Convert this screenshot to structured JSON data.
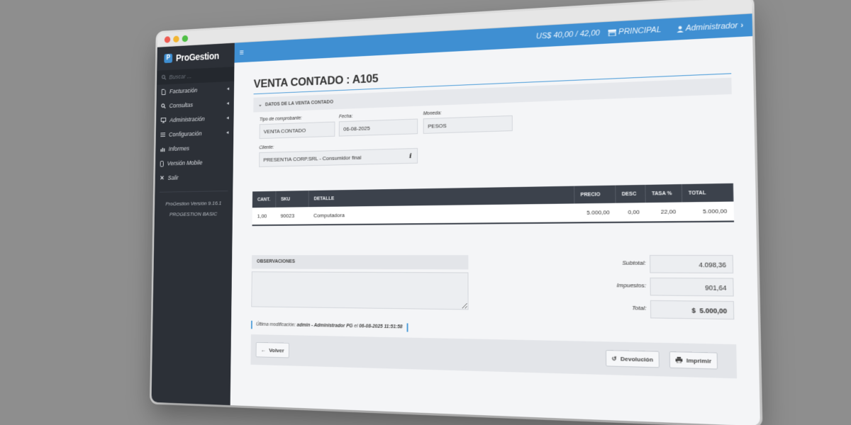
{
  "app": {
    "brand": "ProGestion"
  },
  "topbar": {
    "currency": "US$ 40,00 / 42,00",
    "principal": "PRINCIPAL",
    "user": "Administrador"
  },
  "sidebar": {
    "search_placeholder": "Buscar ...",
    "items": [
      {
        "label": "Facturación",
        "icon": "file-icon",
        "has_arrow": true
      },
      {
        "label": "Consultas",
        "icon": "search-icon",
        "has_arrow": true
      },
      {
        "label": "Administración",
        "icon": "monitor-icon",
        "has_arrow": true
      },
      {
        "label": "Configuración",
        "icon": "sliders-icon",
        "has_arrow": true
      },
      {
        "label": "Informes",
        "icon": "chart-icon",
        "has_arrow": false
      },
      {
        "label": "Versión Mobile",
        "icon": "mobile-icon",
        "has_arrow": false
      },
      {
        "label": "Salir",
        "icon": "close-icon",
        "has_arrow": false
      }
    ],
    "version": "ProGestion Versión 9.16.1",
    "edition": "PROGESTION BASIC"
  },
  "page": {
    "title": "VENTA CONTADO : A105",
    "panel_title": "DATOS DE LA VENTA CONTADO",
    "fields": {
      "tipo_label": "Tipo de comprobante:",
      "tipo_value": "VENTA CONTADO",
      "fecha_label": "Fecha:",
      "fecha_value": "06-08-2025",
      "moneda_label": "Moneda:",
      "moneda_value": "PESOS",
      "cliente_label": "Cliente:",
      "cliente_value": "PRESENTIA CORP.SRL - Consumidor final"
    },
    "table": {
      "headers": [
        "CANT.",
        "SKU",
        "DETALLE",
        "PRECIO",
        "DESC",
        "TASA %",
        "TOTAL"
      ],
      "rows": [
        [
          "1,00",
          "90023",
          "Computadora",
          "5.000,00",
          "0,00",
          "22,00",
          "5.000,00"
        ]
      ]
    },
    "observaciones_label": "OBSERVACIONES",
    "totals": {
      "subtotal_label": "Subtotal:",
      "subtotal_value": "4.098,36",
      "impuestos_label": "Impuestos:",
      "impuestos_value": "901,64",
      "total_label": "Total:",
      "total_currency": "$",
      "total_value": "5.000,00"
    },
    "audit": {
      "prefix": "Última modificación:",
      "user": "admin - Administrador PG",
      "connector": "el",
      "datetime": "06-08-2025 11:51:58"
    },
    "buttons": {
      "back": "Volver",
      "refund": "Devolución",
      "print": "Imprimir"
    }
  }
}
